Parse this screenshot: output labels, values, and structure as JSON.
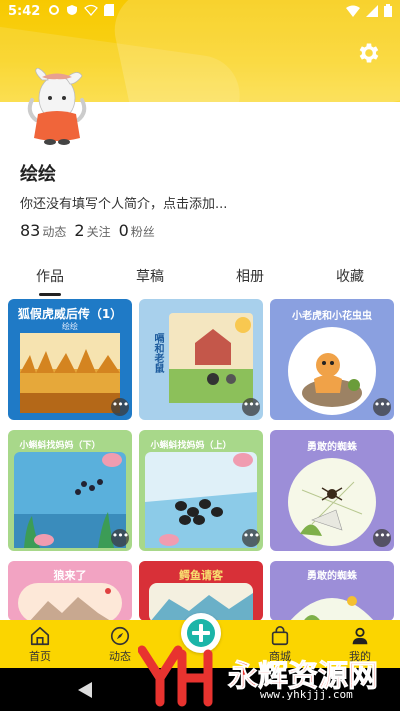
{
  "status_bar": {
    "time": "5:42"
  },
  "profile": {
    "name": "绘绘",
    "bio": "你还没有填写个人简介，点击添加...",
    "stats": [
      {
        "count": "83",
        "label": "动态"
      },
      {
        "count": "2",
        "label": "关注"
      },
      {
        "count": "0",
        "label": "粉丝"
      }
    ]
  },
  "tabs": [
    {
      "label": "作品",
      "active": true
    },
    {
      "label": "草稿",
      "active": false
    },
    {
      "label": "相册",
      "active": false
    },
    {
      "label": "收藏",
      "active": false
    }
  ],
  "works": [
    {
      "title": "狐假虎威后传（1）",
      "subtitle": "绘绘",
      "bg": "#1f7ac6"
    },
    {
      "title": "嗝和老鼠",
      "subtitle": "",
      "bg": "#7fb6d9"
    },
    {
      "title": "小老虎和小花虫虫",
      "subtitle": "",
      "bg": "#8aa0e0"
    },
    {
      "title": "小蝌蚪找妈妈（下）",
      "subtitle": "",
      "bg": "#a8d88a"
    },
    {
      "title": "小蝌蚪找妈妈（上）",
      "subtitle": "",
      "bg": "#a8d88a"
    },
    {
      "title": "勇敢的蜘蛛",
      "subtitle": "",
      "bg": "#9c8ed8"
    },
    {
      "title": "狼来了",
      "subtitle": "",
      "bg": "#f2a3c2"
    },
    {
      "title": "鳄鱼请客",
      "subtitle": "",
      "bg": "#d83038"
    },
    {
      "title": "勇敢的蜘蛛",
      "subtitle": "",
      "bg": "#9c8ed8"
    }
  ],
  "more_label": "•••",
  "bottom_nav": [
    {
      "label": "首页",
      "icon": "home-icon"
    },
    {
      "label": "动态",
      "icon": "compass-icon"
    },
    {
      "label": "",
      "icon": "add-icon"
    },
    {
      "label": "商城",
      "icon": "bag-icon"
    },
    {
      "label": "我的",
      "icon": "user-icon"
    }
  ],
  "watermark": {
    "text": "永辉资源网",
    "url": "www.yhkjjj.com"
  },
  "colors": {
    "accent": "#fbd500",
    "fab_plus": "#1bb5a8"
  }
}
